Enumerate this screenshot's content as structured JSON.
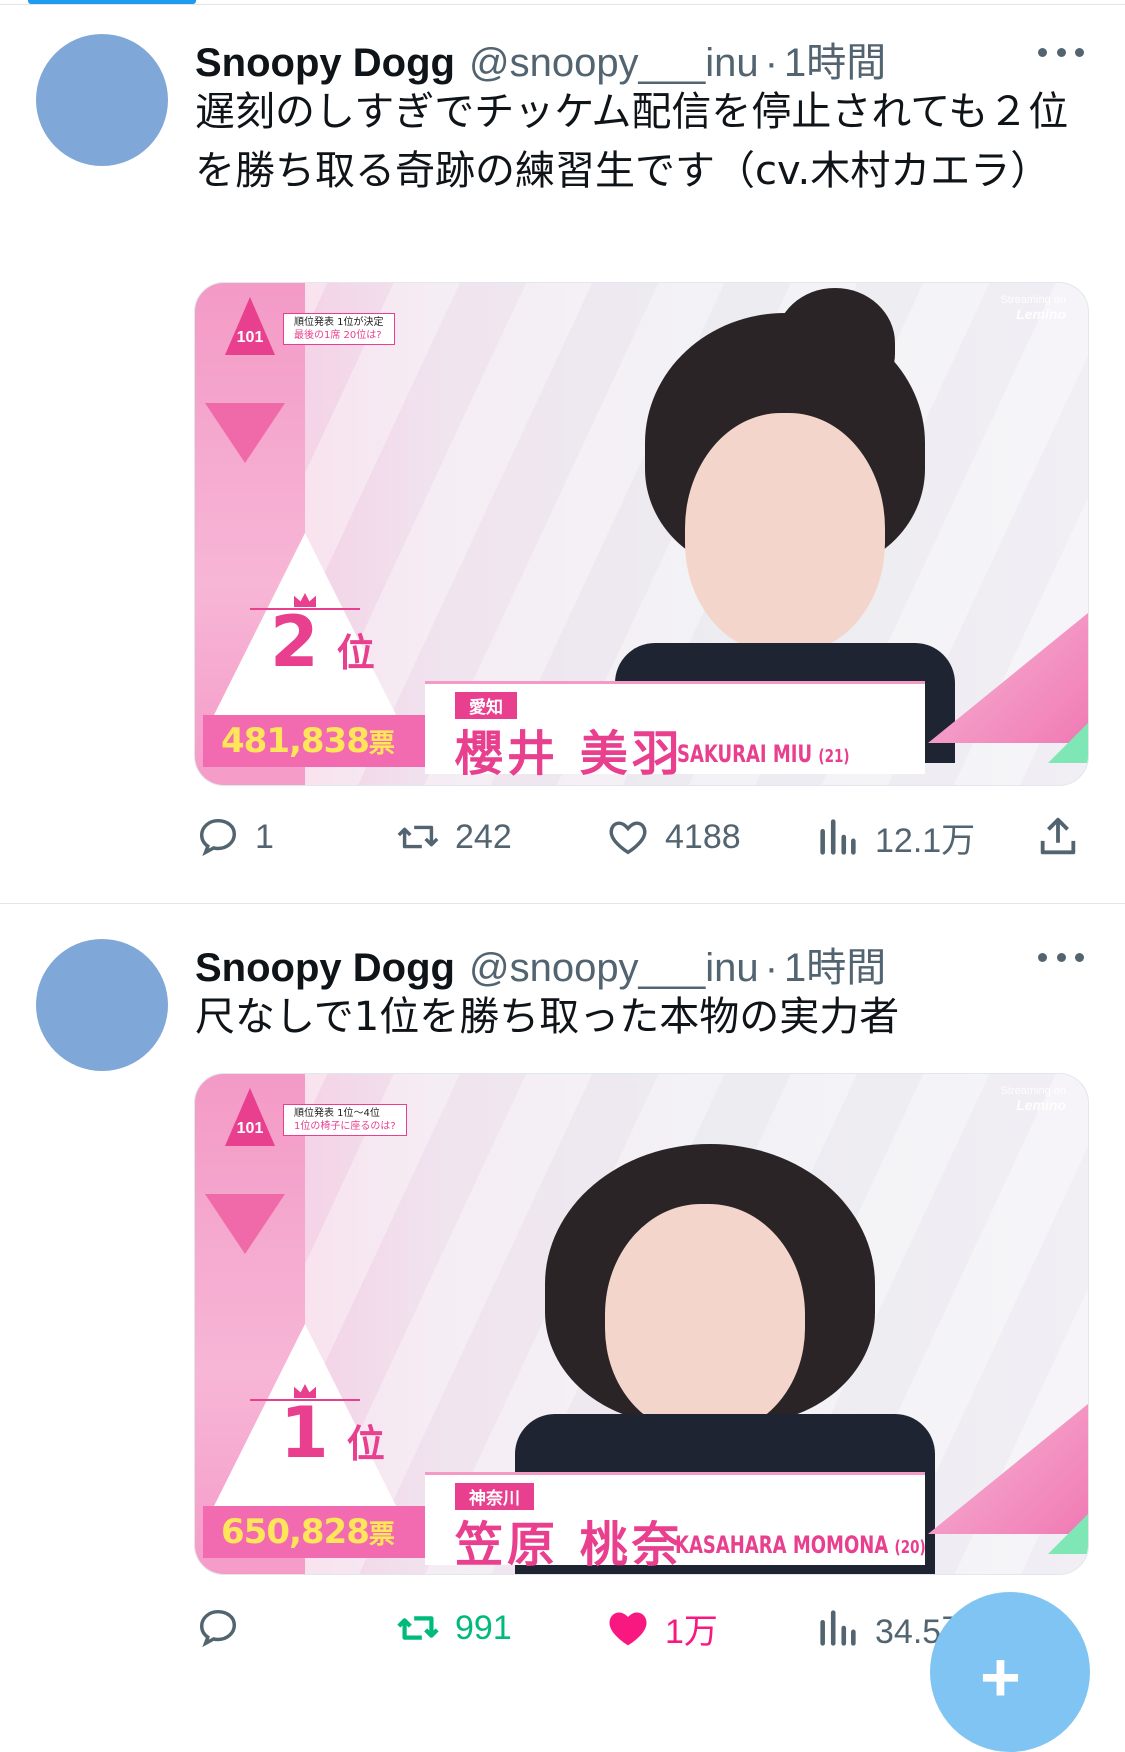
{
  "tweets": [
    {
      "author_name": "Snoopy Dogg",
      "handle": "@snoopy___inu",
      "separator": "·",
      "time": "1時間",
      "text": "遅刻のしすぎでチッケム配信を停止されても２位を勝ち取る奇跡の練習生です（cv.木村カエラ）",
      "media": {
        "logo_text": "101",
        "caption_line1": "順位発表 1位が決定",
        "caption_line2": "最後の1席 20位は?",
        "streaming_label": "Streaming on",
        "streaming_brand": "Lemino",
        "rank_number": "2",
        "rank_suffix": "位",
        "votes": "481,838",
        "votes_unit": "票",
        "prefecture": "愛知",
        "name_jp": "櫻井 美羽",
        "name_romaji": "SAKURAI MIU",
        "age": "(21)"
      },
      "actions": {
        "reply_count": "1",
        "retweet_count": "242",
        "like_count": "4188",
        "views_count": "12.1万",
        "retweeted": false,
        "liked": false
      }
    },
    {
      "author_name": "Snoopy Dogg",
      "handle": "@snoopy___inu",
      "separator": "·",
      "time": "1時間",
      "text": "尺なしで1位を勝ち取った本物の実力者",
      "media": {
        "logo_text": "101",
        "caption_line1": "順位発表 1位〜4位",
        "caption_line2": "1位の椅子に座るのは?",
        "streaming_label": "Streaming on",
        "streaming_brand": "Lemino",
        "rank_number": "1",
        "rank_suffix": "位",
        "votes": "650,828",
        "votes_unit": "票",
        "prefecture": "神奈川",
        "name_jp": "笠原 桃奈",
        "name_romaji": "KASAHARA MOMONA",
        "age": "(20)"
      },
      "actions": {
        "reply_count": "",
        "retweet_count": "991",
        "like_count": "1万",
        "views_count": "34.5万",
        "retweeted": true,
        "liked": true
      }
    }
  ],
  "colors": {
    "accent_blue": "#1d9bf0",
    "retweet_green": "#00ba7c",
    "like_pink": "#f91880",
    "secondary_text": "#536471",
    "show_pink": "#e83f8e"
  },
  "fab": {
    "icon": "plus-icon",
    "label": "+"
  }
}
